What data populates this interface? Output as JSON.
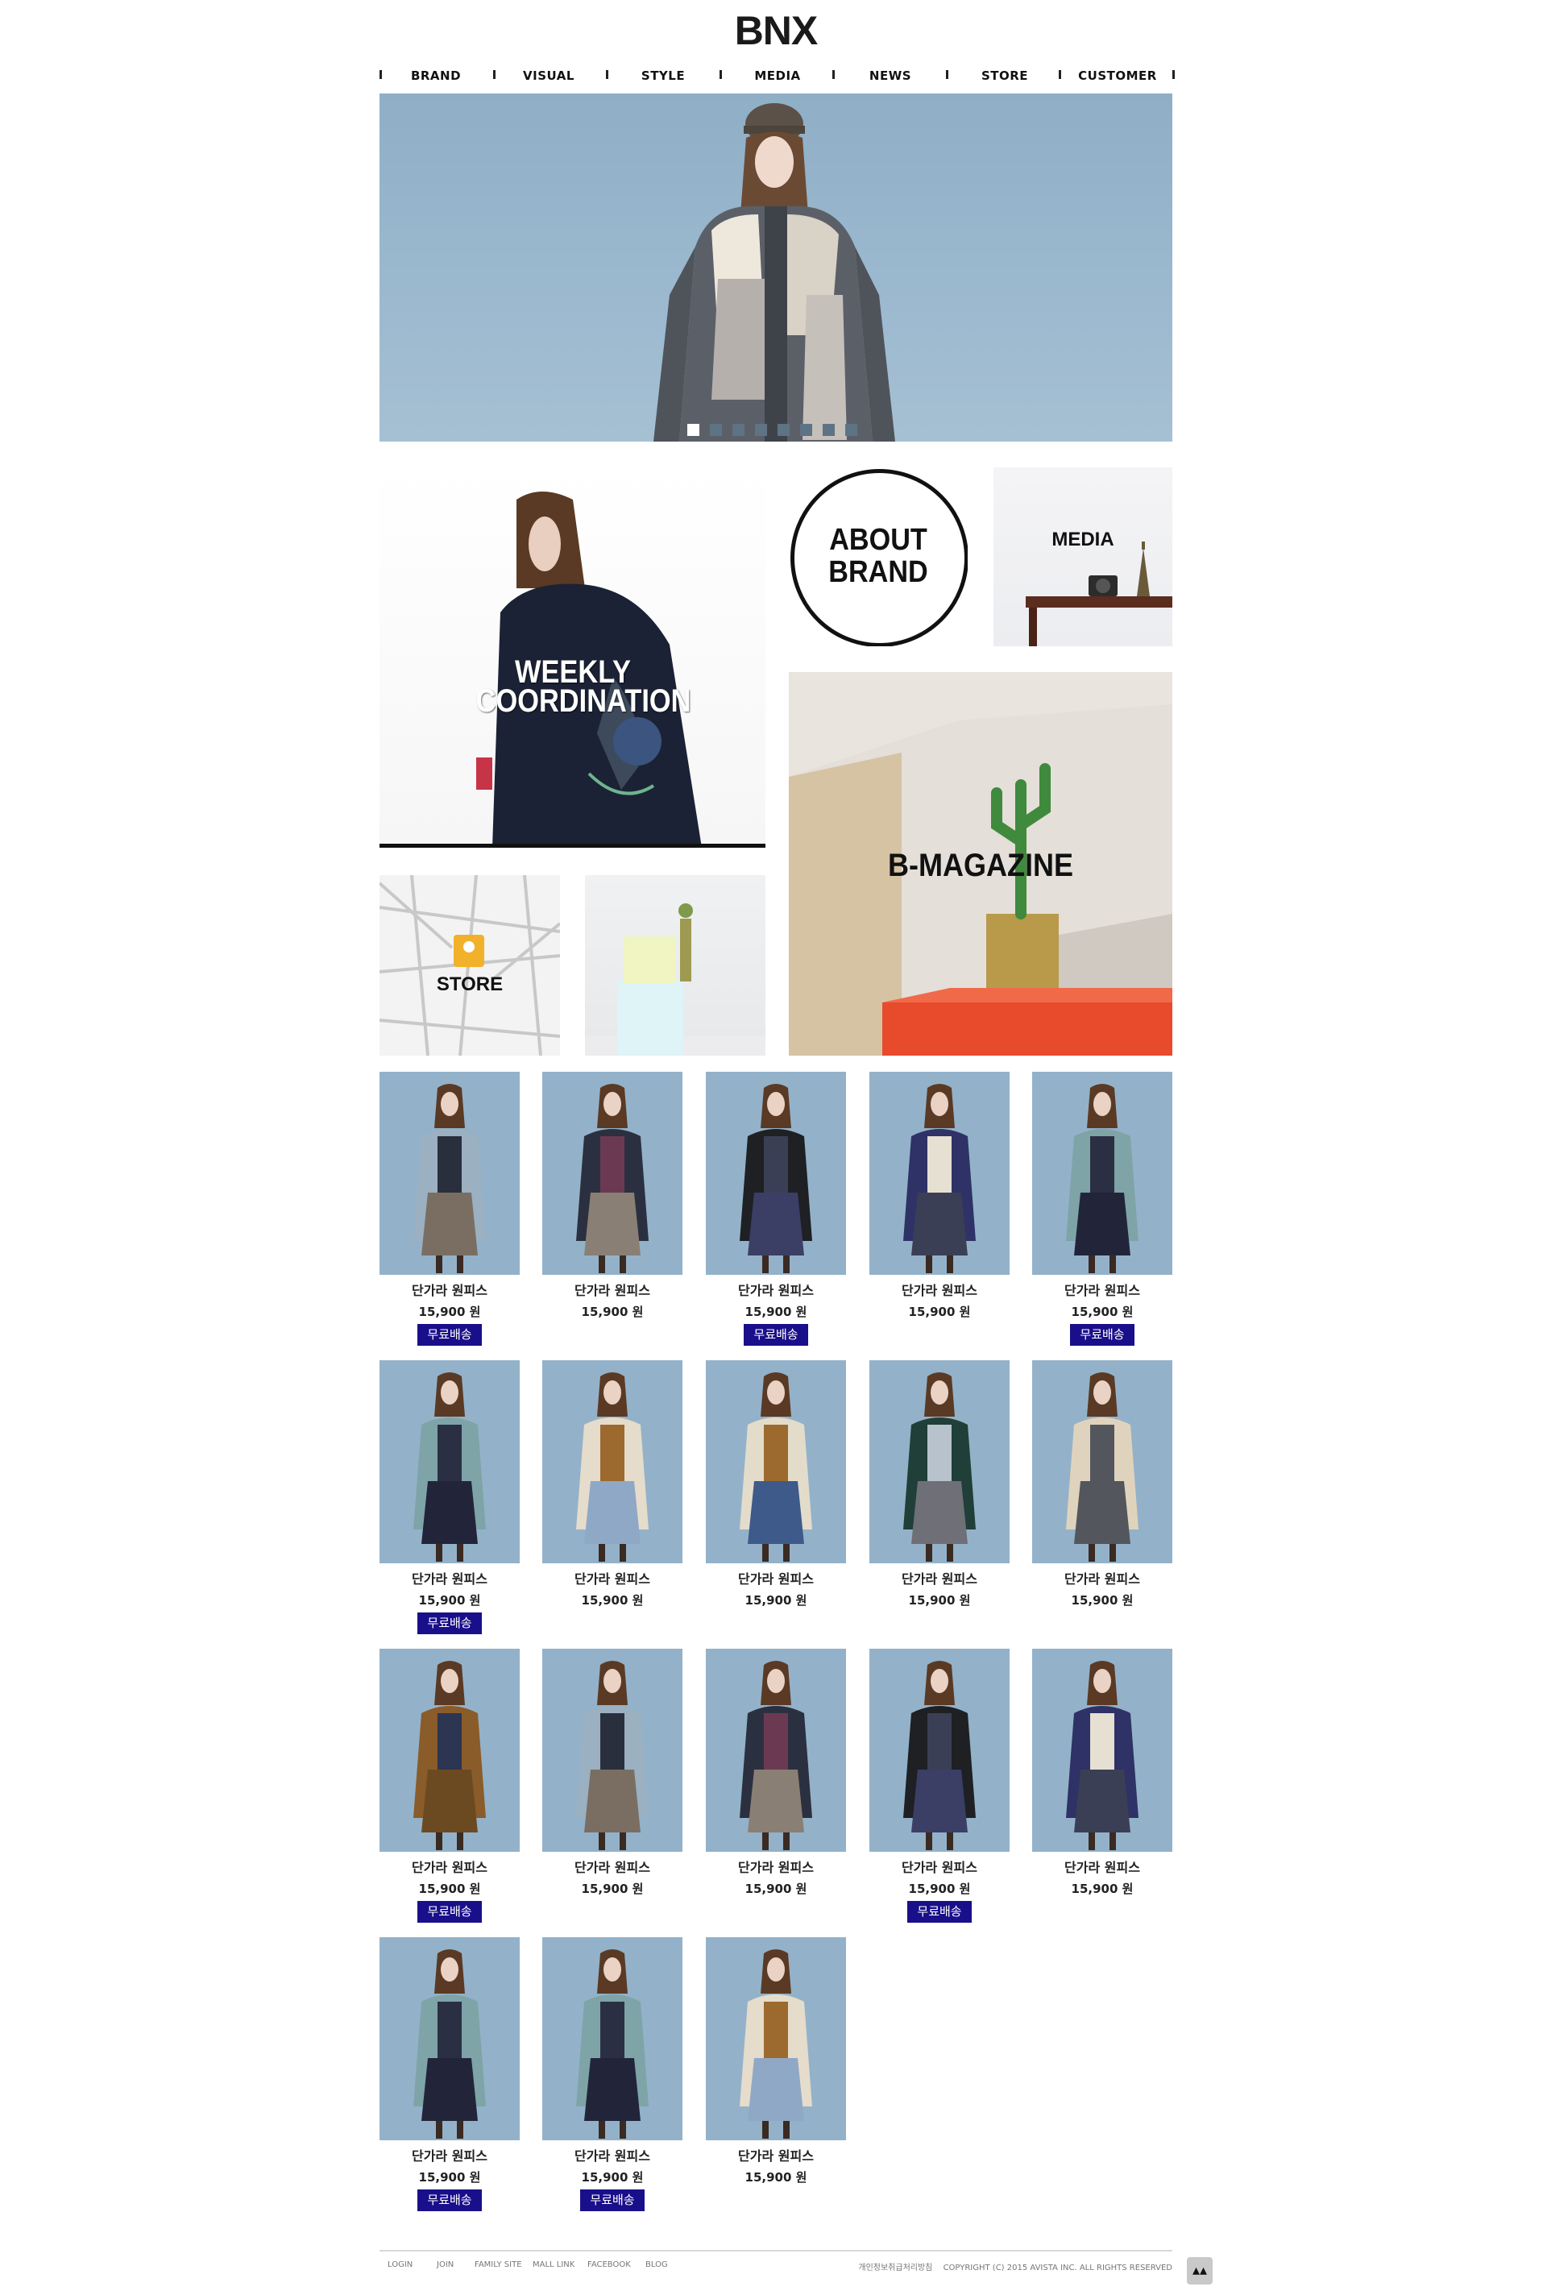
{
  "brand": {
    "logo_text": "BNX"
  },
  "nav": {
    "items": [
      "BRAND",
      "VISUAL",
      "STYLE",
      "MEDIA",
      "NEWS",
      "STORE",
      "CUSTOMER"
    ]
  },
  "hero": {
    "slide_count": 8,
    "active_index": 0
  },
  "tiles": {
    "weekly": "WEEKLY\nCOORDINATION",
    "about": "ABOUT\nBRAND",
    "media": "MEDIA",
    "bmagazine": "B-MAGAZINE",
    "store": "STORE"
  },
  "products": [
    {
      "name": "단가라 원피스",
      "price": "15,900 원",
      "badge": "무료배송",
      "coat": "#9bb0c0",
      "inner": "#2a2f3d",
      "skirt": "#7a6e62"
    },
    {
      "name": "단가라 원피스",
      "price": "15,900 원",
      "badge": null,
      "coat": "#2b3040",
      "inner": "#6b3a52",
      "skirt": "#8a7f74"
    },
    {
      "name": "단가라 원피스",
      "price": "15,900 원",
      "badge": "무료배송",
      "coat": "#1e2024",
      "inner": "#3a3f55",
      "skirt": "#3b3f66"
    },
    {
      "name": "단가라 원피스",
      "price": "15,900 원",
      "badge": null,
      "coat": "#2e3266",
      "inner": "#e6e0d2",
      "skirt": "#3a3f55"
    },
    {
      "name": "단가라 원피스",
      "price": "15,900 원",
      "badge": "무료배송",
      "coat": "#7ea4a8",
      "inner": "#2b2f44",
      "skirt": "#22253a"
    },
    {
      "name": "단가라 원피스",
      "price": "15,900 원",
      "badge": "무료배송",
      "coat": "#7ea4a8",
      "inner": "#2b2f44",
      "skirt": "#22253a"
    },
    {
      "name": "단가라 원피스",
      "price": "15,900 원",
      "badge": null,
      "coat": "#e5dccb",
      "inner": "#9c6a2e",
      "skirt": "#8fa8c6"
    },
    {
      "name": "단가라 원피스",
      "price": "15,900 원",
      "badge": null,
      "coat": "#e3dccb",
      "inner": "#9c6a2e",
      "skirt": "#3e5a8a"
    },
    {
      "name": "단가라 원피스",
      "price": "15,900 원",
      "badge": null,
      "coat": "#1f3f38",
      "inner": "#b8c2cc",
      "skirt": "#6f6f78"
    },
    {
      "name": "단가라 원피스",
      "price": "15,900 원",
      "badge": null,
      "coat": "#e0d3bd",
      "inner": "#54565e",
      "skirt": "#54565e"
    },
    {
      "name": "단가라 원피스",
      "price": "15,900 원",
      "badge": "무료배송",
      "coat": "#8a5c2a",
      "inner": "#2c3552",
      "skirt": "#6b4a22"
    },
    {
      "name": "단가라 원피스",
      "price": "15,900 원",
      "badge": null,
      "coat": "#9bb0c0",
      "inner": "#2a2f3d",
      "skirt": "#7a6e62"
    },
    {
      "name": "단가라 원피스",
      "price": "15,900 원",
      "badge": null,
      "coat": "#2b3040",
      "inner": "#6b3a52",
      "skirt": "#8a7f74"
    },
    {
      "name": "단가라 원피스",
      "price": "15,900 원",
      "badge": "무료배송",
      "coat": "#1e2024",
      "inner": "#3a3f55",
      "skirt": "#3b3f66"
    },
    {
      "name": "단가라 원피스",
      "price": "15,900 원",
      "badge": null,
      "coat": "#2e3266",
      "inner": "#e6e0d2",
      "skirt": "#3a3f55"
    },
    {
      "name": "단가라 원피스",
      "price": "15,900 원",
      "badge": "무료배송",
      "coat": "#7ea4a8",
      "inner": "#2b2f44",
      "skirt": "#22253a"
    },
    {
      "name": "단가라 원피스",
      "price": "15,900 원",
      "badge": "무료배송",
      "coat": "#7ea4a8",
      "inner": "#2b2f44",
      "skirt": "#22253a"
    },
    {
      "name": "단가라 원피스",
      "price": "15,900 원",
      "badge": null,
      "coat": "#e5dccb",
      "inner": "#9c6a2e",
      "skirt": "#8fa8c6"
    }
  ],
  "footer": {
    "links": [
      "LOGIN",
      "JOIN",
      "FAMILY SITE",
      "MALL LINK",
      "FACEBOOK",
      "BLOG"
    ],
    "privacy": "개인정보취급처리방침",
    "copyright": "COPYRIGHT (C) 2015 AVISTA INC. ALL RIGHTS RESERVED"
  },
  "colors": {
    "badge_bg": "#1a0f8a",
    "hero_bg": "#9cb9cf"
  },
  "icons": {
    "top_button": "double-chevron-up-icon",
    "store_pin": "map-pin-icon"
  }
}
